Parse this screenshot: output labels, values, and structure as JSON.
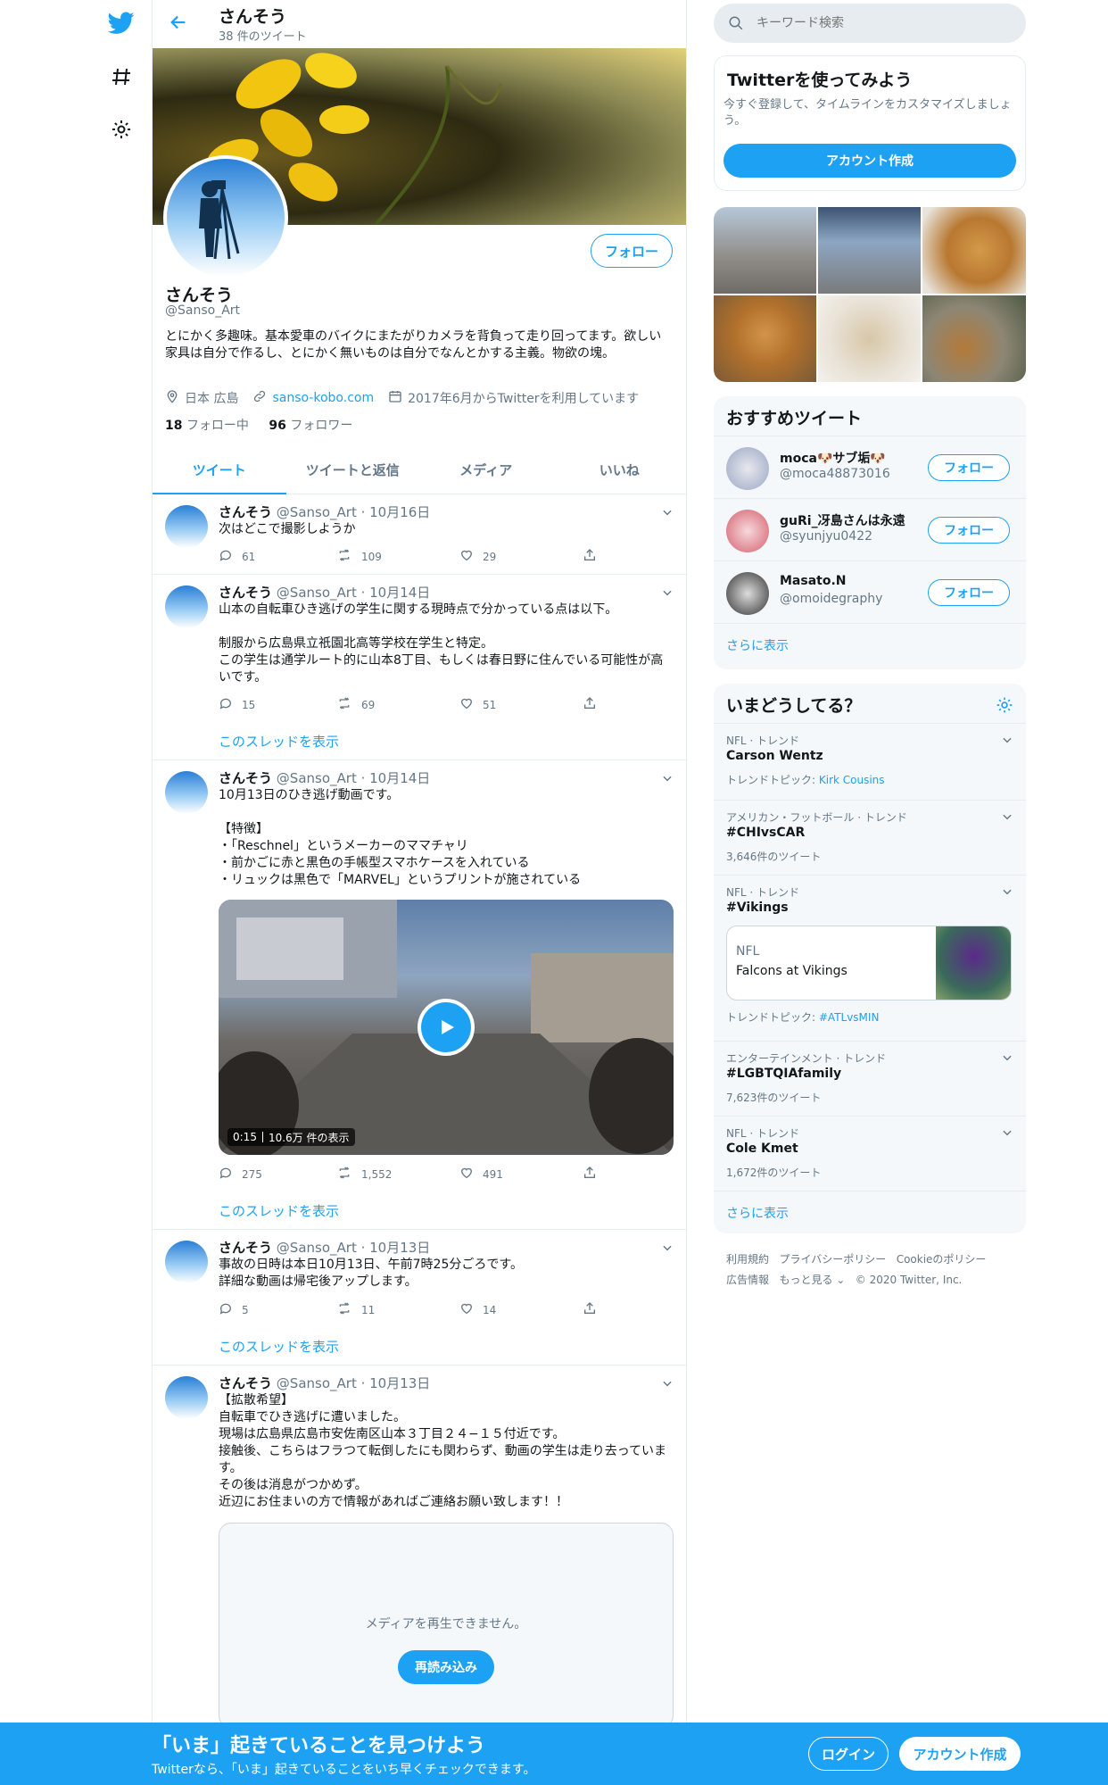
{
  "nav": {
    "logo": "twitter-bird-icon",
    "explore": "hashtag-icon",
    "settings": "gear-icon"
  },
  "header": {
    "title": "さんそう",
    "tweet_count": "38 件のツイート"
  },
  "profile": {
    "name": "さんそう",
    "handle": "@Sanso_Art",
    "follow_label": "フォロー",
    "bio": "とにかく多趣味。基本愛車のバイクにまたがりカメラを背負って走り回ってます。欲しい家具は自分で作るし、とにかく無いものは自分でなんとかする主義。物欲の塊。",
    "location": "日本 広島",
    "website": "sanso-kobo.com",
    "joined": "2017年6月からTwitterを利用しています",
    "following_count": "18",
    "following_label": "フォロー中",
    "followers_count": "96",
    "followers_label": "フォロワー"
  },
  "tabs": [
    "ツイート",
    "ツイートと返信",
    "メディア",
    "いいね"
  ],
  "tweets": [
    {
      "name": "さんそう",
      "meta": "@Sanso_Art · 10月16日",
      "text": "次はどこで撮影しようか",
      "replies": "61",
      "retweets": "109",
      "likes": "29"
    },
    {
      "name": "さんそう",
      "meta": "@Sanso_Art · 10月14日",
      "text": "山本の自転車ひき逃げの学生に関する現時点で分かっている点は以下。\n\n制服から広島県立祇園北高等学校在学生と特定。\nこの学生は通学ルート的に山本8丁目、もしくは春日野に住んでいる可能性が高いです。",
      "replies": "15",
      "retweets": "69",
      "likes": "51",
      "thread": "このスレッドを表示"
    },
    {
      "name": "さんそう",
      "meta": "@Sanso_Art · 10月14日",
      "text": "10月13日のひき逃げ動画です。\n\n【特徴】\n・「Reschnel」というメーカーのママチャリ\n・前かごに赤と黒色の手帳型スマホケースを入れている\n・リュックは黒色で「MARVEL」というプリントが施されている",
      "video_time": "0:15",
      "video_views": "10.6万 件の表示",
      "replies": "275",
      "retweets": "1,552",
      "likes": "491",
      "thread": "このスレッドを表示"
    },
    {
      "name": "さんそう",
      "meta": "@Sanso_Art · 10月13日",
      "text": "事故の日時は本日10月13日、午前7時25分ごろです。\n詳細な動画は帰宅後アップします。",
      "replies": "5",
      "retweets": "11",
      "likes": "14",
      "thread": "このスレッドを表示"
    },
    {
      "name": "さんそう",
      "meta": "@Sanso_Art · 10月13日",
      "text": "【拡散希望】\n自転車でひき逃げに遭いました。\n現場は広島県広島市安佐南区山本３丁目２４−１５付近です。\n接触後、こちらはフラつて転倒したにも関わらず、動画の学生は走り去っています。\nその後は消息がつかめず。\n近辺にお住まいの方で情報があればご連絡お願い致します！！",
      "media_error": "メディアを再生できません。",
      "reload": "再読み込み"
    }
  ],
  "search": {
    "placeholder": "キーワード検索"
  },
  "signup_card": {
    "title": "Twitterを使ってみよう",
    "text": "今すぐ登録して、タイムラインをカスタマイズしましょう。",
    "button": "アカウント作成"
  },
  "recommended": {
    "title": "おすすめツイート",
    "users": [
      {
        "name": "moca🐶サブ垢🐶",
        "handle": "@moca48873016",
        "follow": "フォロー"
      },
      {
        "name": "guRi_冴島さんは永遠",
        "handle": "@syunjyu0422",
        "follow": "フォロー"
      },
      {
        "name": "Masato.N",
        "handle": "@omoidegraphy",
        "follow": "フォロー"
      }
    ],
    "more": "さらに表示"
  },
  "trends": {
    "title": "いまどうしてる？",
    "items": [
      {
        "category": "NFL · トレンド",
        "title": "Carson Wentz",
        "sub_prefix": "トレンドトピック: ",
        "sub_link": "Kirk Cousins"
      },
      {
        "category": "アメリカン・フットボール · トレンド",
        "title": "#CHIvsCAR",
        "sub": "3,646件のツイート"
      },
      {
        "category": "NFL · トレンド",
        "title": "#Vikings",
        "card_kicker": "NFL",
        "card_title": "Falcons at Vikings",
        "sub_prefix": "トレンドトピック: ",
        "sub_link": "#ATLvsMIN"
      },
      {
        "category": "エンターテインメント · トレンド",
        "title": "#LGBTQIAfamily",
        "sub": "7,623件のツイート"
      },
      {
        "category": "NFL · トレンド",
        "title": "Cole Kmet",
        "sub": "1,672件のツイート"
      }
    ],
    "more": "さらに表示"
  },
  "footer": {
    "links1": [
      "利用規約",
      "プライバシーポリシー",
      "Cookieのポリシー"
    ],
    "links2": [
      "広告情報",
      "もっと見る ⌄",
      "© 2020 Twitter, Inc."
    ]
  },
  "bottom_bar": {
    "headline": "「いま」起きていることを見つけよう",
    "sub": "Twitterなら、「いま」起きていることをいち早くチェックできます。",
    "login": "ログイン",
    "signup": "アカウント作成"
  },
  "colors": {
    "accent": "#1da1f2",
    "muted": "#657786",
    "border": "#e6ecf0",
    "panel": "#f5f8fa"
  }
}
